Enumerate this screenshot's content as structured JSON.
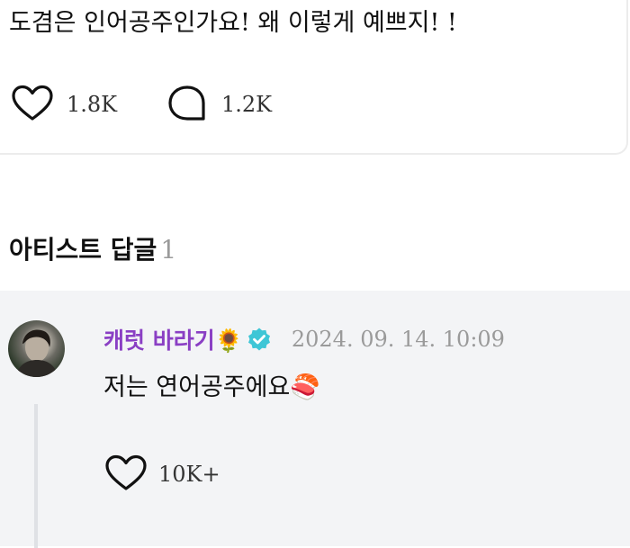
{
  "post": {
    "text": "도겸은 인어공주인가요! 왜 이렇게 예쁘지! !",
    "likes": "1.8K",
    "comments": "1.2K"
  },
  "section": {
    "title": "아티스트 답글",
    "count": "1"
  },
  "reply": {
    "author": "캐럿 바라기",
    "author_emoji": "🌻",
    "timestamp": "2024. 09. 14. 10:09",
    "text": "저는 연어공주에요",
    "text_emoji": "🍣",
    "likes": "10K+"
  },
  "colors": {
    "author_name": "#8a3fc4",
    "verified_badge": "#3ec6d6",
    "reply_background": "#f3f4f6",
    "muted_text": "#9a9a9a"
  },
  "icons": {
    "like": "heart-outline-icon",
    "comment": "speech-bubble-outline-icon",
    "verified": "verified-check-badge-icon"
  }
}
